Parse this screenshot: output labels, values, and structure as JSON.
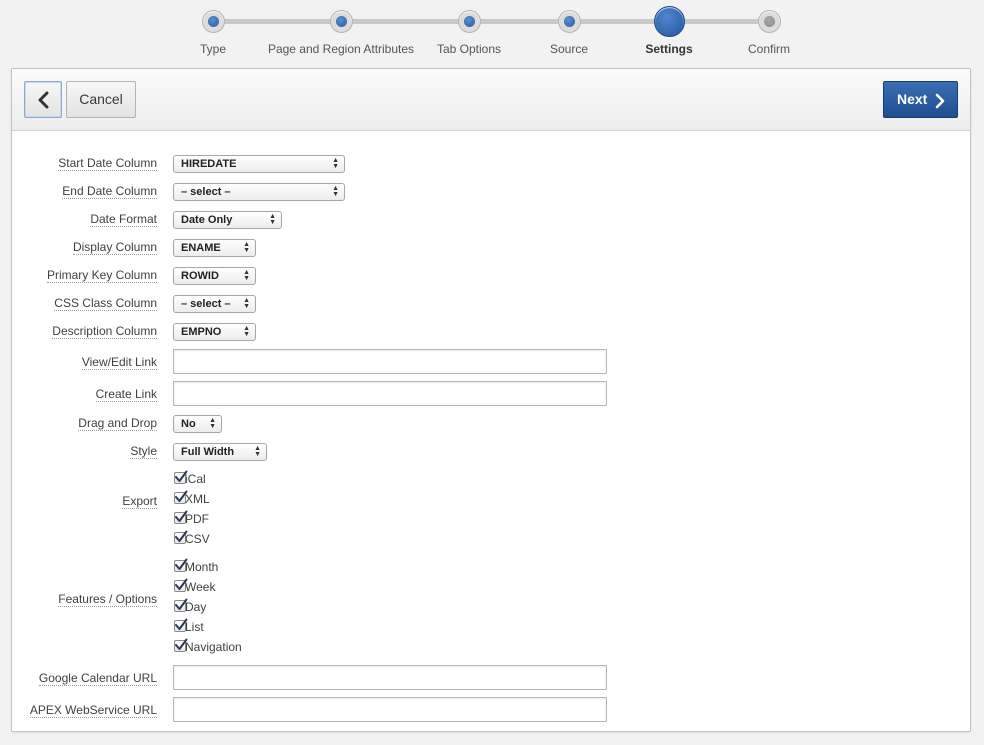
{
  "wizard": {
    "steps": [
      {
        "label": "Type",
        "state": "done"
      },
      {
        "label": "Page and Region Attributes",
        "state": "done"
      },
      {
        "label": "Tab Options",
        "state": "done"
      },
      {
        "label": "Source",
        "state": "done"
      },
      {
        "label": "Settings",
        "state": "current"
      },
      {
        "label": "Confirm",
        "state": "upcoming"
      }
    ]
  },
  "buttons": {
    "back_icon": "chevron-left-icon",
    "cancel_label": "Cancel",
    "next_label": "Next",
    "next_icon": "chevron-right-icon"
  },
  "form": {
    "start_date": {
      "label": "Start Date Column",
      "value": "HIREDATE"
    },
    "end_date": {
      "label": "End Date Column",
      "value": "– select –"
    },
    "date_format": {
      "label": "Date Format",
      "value": "Date Only"
    },
    "display_column": {
      "label": "Display Column",
      "value": "ENAME"
    },
    "primary_key": {
      "label": "Primary Key Column",
      "value": "ROWID"
    },
    "css_class": {
      "label": "CSS Class Column",
      "value": "– select –"
    },
    "description": {
      "label": "Description Column",
      "value": "EMPNO"
    },
    "view_edit_link": {
      "label": "View/Edit Link",
      "value": ""
    },
    "create_link": {
      "label": "Create Link",
      "value": ""
    },
    "drag_drop": {
      "label": "Drag and Drop",
      "value": "No"
    },
    "style": {
      "label": "Style",
      "value": "Full Width"
    },
    "export": {
      "label": "Export",
      "options": [
        {
          "label": "iCal",
          "checked": true
        },
        {
          "label": "XML",
          "checked": true
        },
        {
          "label": "PDF",
          "checked": true
        },
        {
          "label": "CSV",
          "checked": true
        }
      ]
    },
    "features": {
      "label": "Features / Options",
      "options": [
        {
          "label": "Month",
          "checked": true
        },
        {
          "label": "Week",
          "checked": true
        },
        {
          "label": "Day",
          "checked": true
        },
        {
          "label": "List",
          "checked": true
        },
        {
          "label": "Navigation",
          "checked": true
        }
      ]
    },
    "google_calendar_url": {
      "label": "Google Calendar URL",
      "value": ""
    },
    "apex_webservice_url": {
      "label": "APEX WebService URL",
      "value": ""
    }
  },
  "colors": {
    "accent": "#24579c",
    "next_button": "#2a5e9f",
    "background": "#f2f2f2"
  }
}
